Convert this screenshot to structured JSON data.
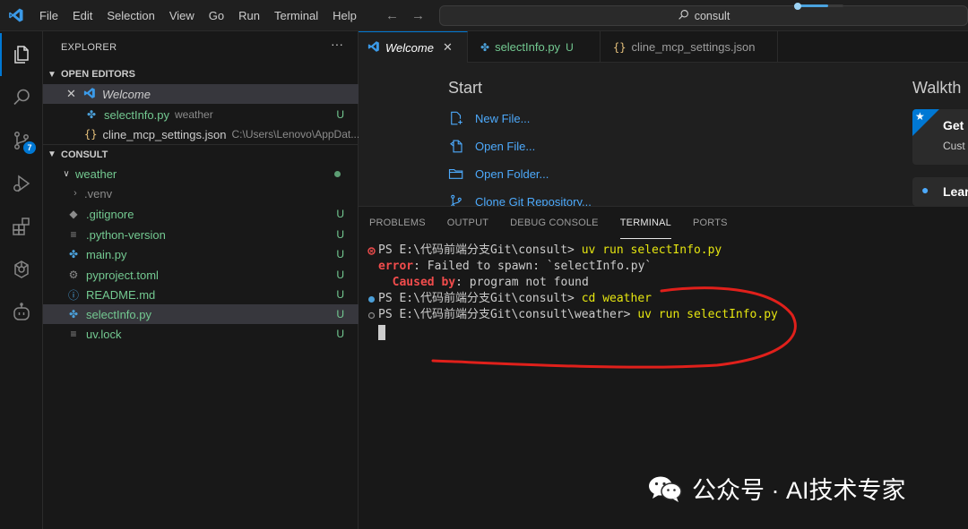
{
  "menu": [
    "File",
    "Edit",
    "Selection",
    "View",
    "Go",
    "Run",
    "Terminal",
    "Help"
  ],
  "search": {
    "text": "consult",
    "icon": "search-icon"
  },
  "activity": {
    "source_control_badge": "7"
  },
  "explorer": {
    "title": "EXPLORER",
    "more": "···",
    "open_editors": {
      "label": "OPEN EDITORS",
      "items": [
        {
          "name": "Welcome",
          "close": "✕"
        },
        {
          "name": "selectInfo.py",
          "desc": "weather",
          "status": "U"
        },
        {
          "name": "cline_mcp_settings.json",
          "desc": "C:\\Users\\Lenovo\\AppDat..."
        }
      ]
    },
    "consult": {
      "label": "CONSULT",
      "folder": "weather",
      "files": [
        {
          "name": ".venv",
          "status": ""
        },
        {
          "name": ".gitignore",
          "status": "U"
        },
        {
          "name": ".python-version",
          "status": "U"
        },
        {
          "name": "main.py",
          "status": "U"
        },
        {
          "name": "pyproject.toml",
          "status": "U"
        },
        {
          "name": "README.md",
          "status": "U"
        },
        {
          "name": "selectInfo.py",
          "status": "U"
        },
        {
          "name": "uv.lock",
          "status": "U"
        }
      ]
    }
  },
  "tabs": [
    {
      "label": "Welcome",
      "close": "✕"
    },
    {
      "label": "selectInfo.py",
      "status": "U"
    },
    {
      "label": "cline_mcp_settings.json"
    }
  ],
  "welcome": {
    "start_title": "Start",
    "links": [
      "New File...",
      "Open File...",
      "Open Folder...",
      "Clone Git Repository..."
    ],
    "walkthroughs_title": "Walkth",
    "card1_title": "Get",
    "card1_sub": "Cust",
    "card2_title": "Lear"
  },
  "panel": {
    "tabs": [
      "PROBLEMS",
      "OUTPUT",
      "DEBUG CONSOLE",
      "TERMINAL",
      "PORTS"
    ],
    "active_tab": "TERMINAL",
    "lines": {
      "l1_prompt": "PS E:\\代码前端分支Git\\consult> ",
      "l1_cmd": "uv run selectInfo.py",
      "l2_label": "error",
      "l2_text": ": Failed to spawn: `selectInfo.py`",
      "l3_label": "  Caused by",
      "l3_text": ": program not found",
      "l4_prompt": "PS E:\\代码前端分支Git\\consult> ",
      "l4_cmd": "cd weather",
      "l5_prompt": "PS E:\\代码前端分支Git\\consult\\weather> ",
      "l5_cmd": "uv run selectInfo.py"
    }
  },
  "colors": {
    "accent": "#0078d4",
    "untracked": "#73c991",
    "link": "#4daafc",
    "error": "#f14c4c",
    "command": "#e5e510",
    "annotation": "#e0201b"
  },
  "watermark": "公众号 · AI技术专家"
}
